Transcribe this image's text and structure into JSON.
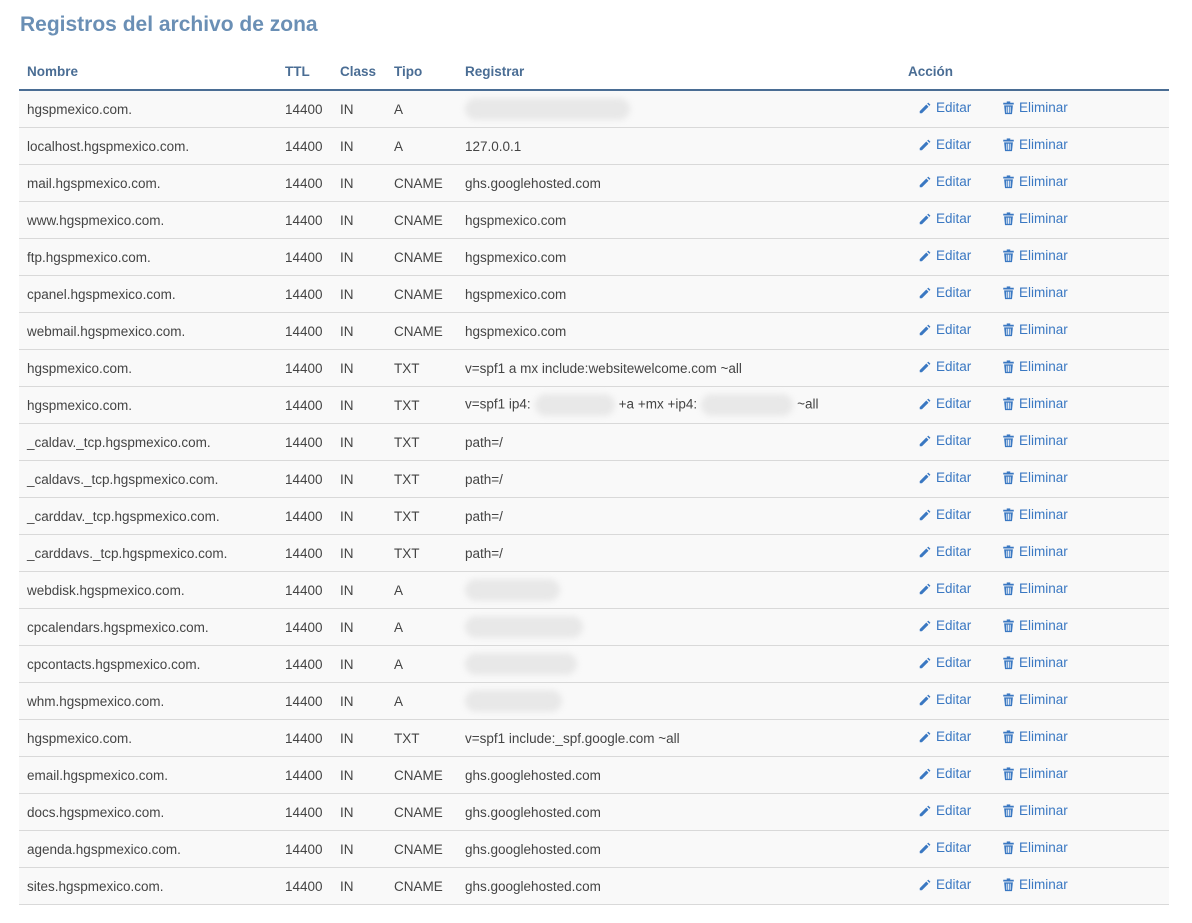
{
  "page": {
    "title": "Registros del archivo de zona"
  },
  "table": {
    "headers": {
      "name": "Nombre",
      "ttl": "TTL",
      "class": "Class",
      "type": "Tipo",
      "record": "Registrar",
      "action": "Acción"
    },
    "edit_label": "Editar",
    "delete_label": "Eliminar",
    "edit_icon": "pencil-icon",
    "delete_icon": "trash-icon",
    "accent_color": "#3a78c2",
    "header_color": "#4a6d94",
    "rows": [
      {
        "name": "hgspmexico.com.",
        "ttl": "14400",
        "class": "IN",
        "type": "A",
        "record": "",
        "redacted": true
      },
      {
        "name": "localhost.hgspmexico.com.",
        "ttl": "14400",
        "class": "IN",
        "type": "A",
        "record": "127.0.0.1"
      },
      {
        "name": "mail.hgspmexico.com.",
        "ttl": "14400",
        "class": "IN",
        "type": "CNAME",
        "record": "ghs.googlehosted.com"
      },
      {
        "name": "www.hgspmexico.com.",
        "ttl": "14400",
        "class": "IN",
        "type": "CNAME",
        "record": "hgspmexico.com"
      },
      {
        "name": "ftp.hgspmexico.com.",
        "ttl": "14400",
        "class": "IN",
        "type": "CNAME",
        "record": "hgspmexico.com"
      },
      {
        "name": "cpanel.hgspmexico.com.",
        "ttl": "14400",
        "class": "IN",
        "type": "CNAME",
        "record": "hgspmexico.com"
      },
      {
        "name": "webmail.hgspmexico.com.",
        "ttl": "14400",
        "class": "IN",
        "type": "CNAME",
        "record": "hgspmexico.com"
      },
      {
        "name": "hgspmexico.com.",
        "ttl": "14400",
        "class": "IN",
        "type": "TXT",
        "record": "v=spf1 a mx include:websitewelcome.com ~all"
      },
      {
        "name": "hgspmexico.com.",
        "ttl": "14400",
        "class": "IN",
        "type": "TXT",
        "record": "",
        "spf_parts": [
          "v=spf1 ip4:",
          "+a +mx +ip4:",
          "~all"
        ]
      },
      {
        "name": "_caldav._tcp.hgspmexico.com.",
        "ttl": "14400",
        "class": "IN",
        "type": "TXT",
        "record": "path=/"
      },
      {
        "name": "_caldavs._tcp.hgspmexico.com.",
        "ttl": "14400",
        "class": "IN",
        "type": "TXT",
        "record": "path=/"
      },
      {
        "name": "_carddav._tcp.hgspmexico.com.",
        "ttl": "14400",
        "class": "IN",
        "type": "TXT",
        "record": "path=/"
      },
      {
        "name": "_carddavs._tcp.hgspmexico.com.",
        "ttl": "14400",
        "class": "IN",
        "type": "TXT",
        "record": "path=/"
      },
      {
        "name": "webdisk.hgspmexico.com.",
        "ttl": "14400",
        "class": "IN",
        "type": "A",
        "record": "",
        "redacted": true
      },
      {
        "name": "cpcalendars.hgspmexico.com.",
        "ttl": "14400",
        "class": "IN",
        "type": "A",
        "record": "",
        "redacted": true
      },
      {
        "name": "cpcontacts.hgspmexico.com.",
        "ttl": "14400",
        "class": "IN",
        "type": "A",
        "record": "",
        "redacted": true
      },
      {
        "name": "whm.hgspmexico.com.",
        "ttl": "14400",
        "class": "IN",
        "type": "A",
        "record": "",
        "redacted": true
      },
      {
        "name": "hgspmexico.com.",
        "ttl": "14400",
        "class": "IN",
        "type": "TXT",
        "record": "v=spf1 include:_spf.google.com ~all"
      },
      {
        "name": "email.hgspmexico.com.",
        "ttl": "14400",
        "class": "IN",
        "type": "CNAME",
        "record": "ghs.googlehosted.com"
      },
      {
        "name": "docs.hgspmexico.com.",
        "ttl": "14400",
        "class": "IN",
        "type": "CNAME",
        "record": "ghs.googlehosted.com"
      },
      {
        "name": "agenda.hgspmexico.com.",
        "ttl": "14400",
        "class": "IN",
        "type": "CNAME",
        "record": "ghs.googlehosted.com"
      },
      {
        "name": "sites.hgspmexico.com.",
        "ttl": "14400",
        "class": "IN",
        "type": "CNAME",
        "record": "ghs.googlehosted.com"
      }
    ]
  }
}
